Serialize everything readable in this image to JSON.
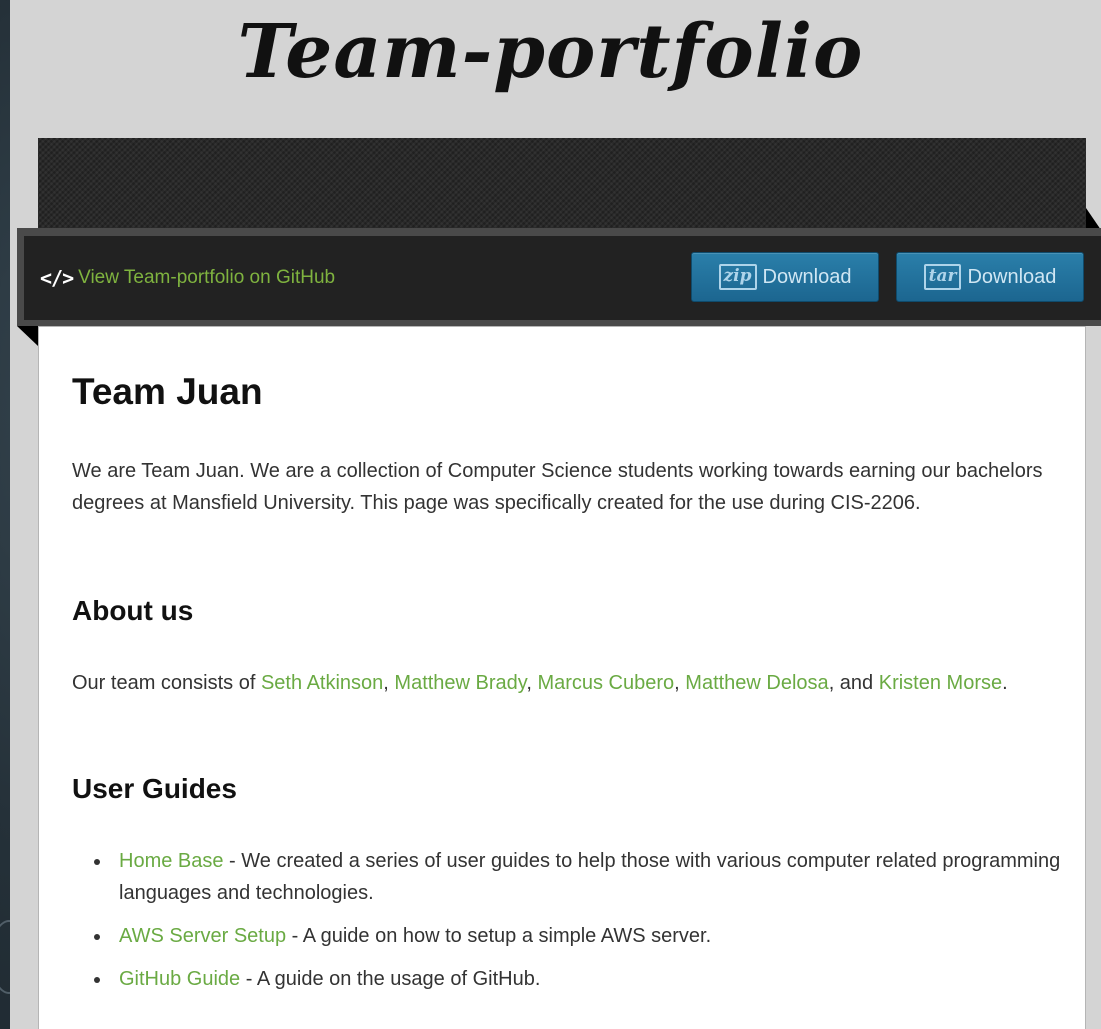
{
  "site": {
    "title": "Team-portfolio"
  },
  "toolbar": {
    "github_icon": "code-icon",
    "github_icon_glyph": "</>",
    "github_link_label": "View Team-portfolio on GitHub",
    "zip_icon_text": "zip",
    "zip_label": "Download",
    "tar_icon_text": "tar",
    "tar_label": "Download"
  },
  "main": {
    "heading": "Team Juan",
    "intro": "We are Team Juan. We are a collection of Computer Science students working towards earning our bachelors degrees at Mansfield University. This page was specifically created for the use during CIS-2206.",
    "about": {
      "heading": "About us",
      "prefix": "Our team consists of ",
      "members": [
        "Seth Atkinson",
        "Matthew Brady",
        "Marcus Cubero",
        "Matthew Delosa",
        "Kristen Morse"
      ],
      "sep": ", ",
      "and": ", and ",
      "end": "."
    },
    "guides": {
      "heading": "User Guides",
      "items": [
        {
          "link": "Home Base",
          "text": " - We created a series of user guides to help those with various computer related programming languages and technologies."
        },
        {
          "link": "AWS Server Setup",
          "text": " - A guide on how to setup a simple AWS server."
        },
        {
          "link": "GitHub Guide",
          "text": " - A guide on the usage of GitHub."
        }
      ]
    }
  },
  "colors": {
    "link": "#6aaa43",
    "button": "#1f6f98",
    "page_bg": "#d4d4d4"
  }
}
